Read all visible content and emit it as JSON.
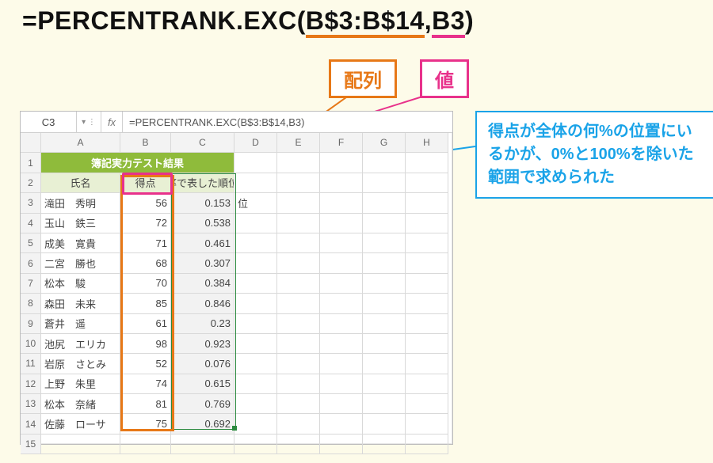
{
  "formula": {
    "func_name": "=PERCENTRANK.EXC(",
    "arg1": "B$3:B$14",
    "comma": ",",
    "arg2": "B3",
    "close": ")"
  },
  "callout_arr": "配列",
  "callout_val": "値",
  "explain": "得点が全体の何%の位置にいるかが、0%と100%を除いた範囲で求められた",
  "excel": {
    "active_cell": "C3",
    "namebox_btns": "▾ ⋮",
    "fx_label": "fx",
    "formula_bar": "=PERCENTRANK.EXC(B$3:B$14,B3)",
    "columns": [
      "A",
      "B",
      "C",
      "D",
      "E",
      "F",
      "G",
      "H"
    ],
    "title_row": "簿記実力テスト結果",
    "headers": {
      "a": "氏名",
      "b": "得点",
      "c": "率で表した順位"
    },
    "d3_value": "位",
    "rows": [
      {
        "n": "滝田　秀明",
        "s": 56,
        "r": "0.153"
      },
      {
        "n": "玉山　鉄三",
        "s": 72,
        "r": "0.538"
      },
      {
        "n": "成美　寛貴",
        "s": 71,
        "r": "0.461"
      },
      {
        "n": "二宮　勝也",
        "s": 68,
        "r": "0.307"
      },
      {
        "n": "松本　駿",
        "s": 70,
        "r": "0.384"
      },
      {
        "n": "森田　未来",
        "s": 85,
        "r": "0.846"
      },
      {
        "n": "蒼井　遥",
        "s": 61,
        "r": "0.23"
      },
      {
        "n": "池尻　エリカ",
        "s": 98,
        "r": "0.923"
      },
      {
        "n": "岩原　さとみ",
        "s": 52,
        "r": "0.076"
      },
      {
        "n": "上野　朱里",
        "s": 74,
        "r": "0.615"
      },
      {
        "n": "松本　奈緒",
        "s": 81,
        "r": "0.769"
      },
      {
        "n": "佐藤　ローサ",
        "s": 75,
        "r": "0.692"
      }
    ]
  }
}
